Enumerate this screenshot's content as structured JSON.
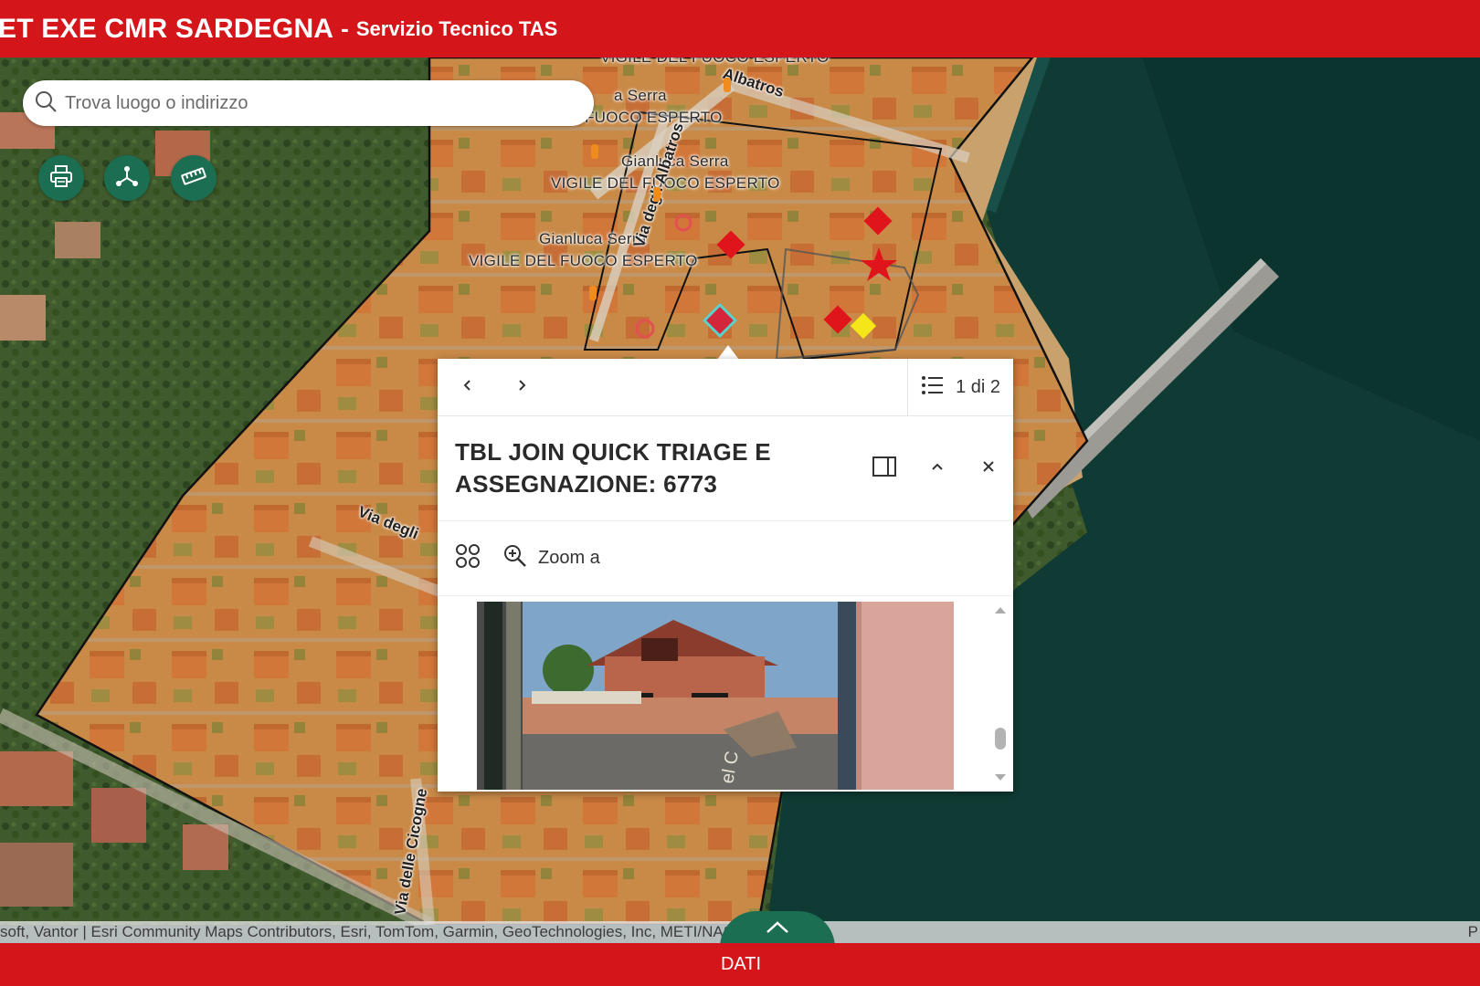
{
  "header": {
    "title": "ET EXE CMR SARDEGNA",
    "separator": "-",
    "subtitle": "Servizio Tecnico TAS",
    "bg_color": "#d4161b"
  },
  "search": {
    "placeholder": "Trova luogo o indirizzo",
    "icon": "search-icon"
  },
  "tools": [
    {
      "name": "print",
      "icon": "print-icon"
    },
    {
      "name": "share",
      "icon": "share-icon"
    },
    {
      "name": "measure",
      "icon": "ruler-icon"
    }
  ],
  "map": {
    "labels": [
      "VIGILE DEL FUOCO ESPERTO",
      "a Serra",
      "FUOCO ESPERTO",
      "Gianluca Serra",
      "VIGILE DEL FUOCO ESPERTO",
      "Gianluca Serra",
      "VIGILE DEL FUOCO ESPERTO"
    ],
    "streets": [
      "Albatros",
      "Via degli Albatros",
      "Via degli",
      "Via delle Cicogne"
    ],
    "marker_colors": {
      "red": "#e0151b",
      "yellow": "#f5e61a",
      "selected": "#d4253d",
      "selection_ring": "#5ad1c8"
    }
  },
  "popup": {
    "prev_icon": "chevron-left-icon",
    "next_icon": "chevron-right-icon",
    "list_icon": "list-icon",
    "pager": "1 di 2",
    "title": "TBL JOIN QUICK TRIAGE E ASSEGNAZIONE: 6773",
    "dock_icon": "dock-side-icon",
    "collapse_icon": "chevron-up-icon",
    "close_icon": "close-icon",
    "actions_icon": "grid-icon",
    "zoom_label": "Zoom a",
    "zoom_icon": "zoom-in-icon",
    "photo_caption": "el C"
  },
  "attribution": {
    "text": "soft, Vantor | Esri Community Maps Contributors, Esri, TomTom, Garmin, GeoTechnologies, Inc, METI/NASA, USGS",
    "right": "P"
  },
  "footer": {
    "label": "DATI",
    "expand_icon": "chevron-up-icon",
    "accent": "#1b6e52"
  }
}
